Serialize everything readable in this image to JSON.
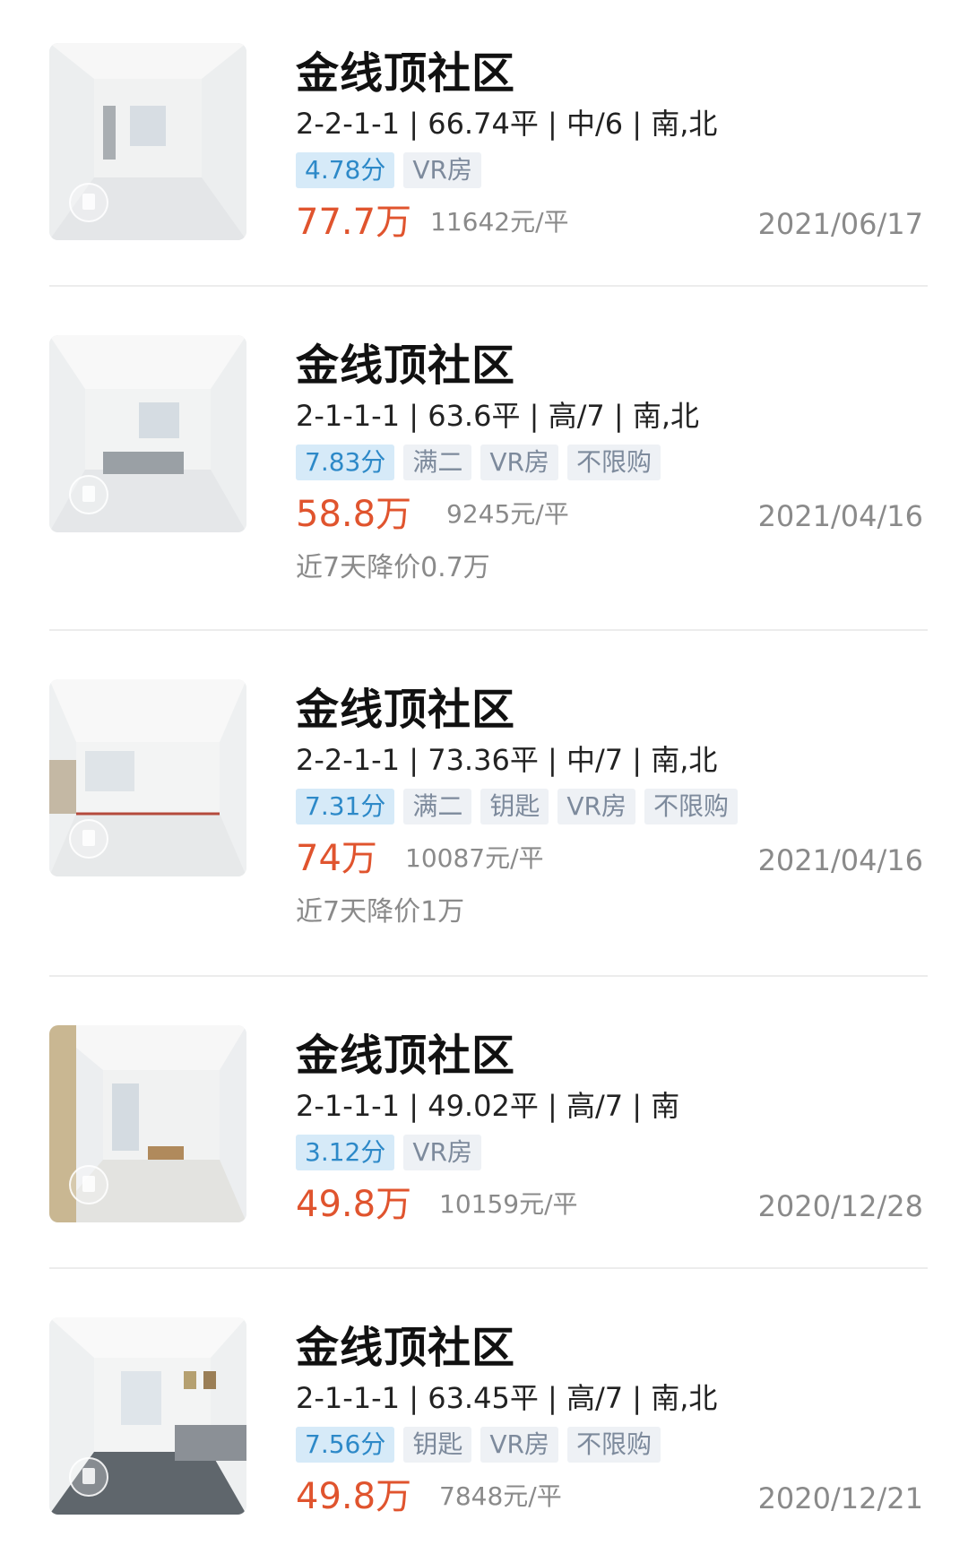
{
  "listings": [
    {
      "title": "金线顶社区",
      "meta": "2-2-1-1 | 66.74平 | 中/6 | 南,北",
      "score": "4.78分",
      "tags": [
        "VR房"
      ],
      "price": "77.7万",
      "unit_price": "11642元/平",
      "date": "2021/06/17",
      "note": ""
    },
    {
      "title": "金线顶社区",
      "meta": "2-1-1-1 | 63.6平 | 高/7 | 南,北",
      "score": "7.83分",
      "tags": [
        "满二",
        "VR房",
        "不限购"
      ],
      "price": "58.8万",
      "unit_price": "9245元/平",
      "date": "2021/04/16",
      "note": "近7天降价0.7万"
    },
    {
      "title": "金线顶社区",
      "meta": "2-2-1-1 | 73.36平 | 中/7 | 南,北",
      "score": "7.31分",
      "tags": [
        "满二",
        "钥匙",
        "VR房",
        "不限购"
      ],
      "price": "74万",
      "unit_price": "10087元/平",
      "date": "2021/04/16",
      "note": "近7天降价1万"
    },
    {
      "title": "金线顶社区",
      "meta": "2-1-1-1 | 49.02平 | 高/7 | 南",
      "score": "3.12分",
      "tags": [
        "VR房"
      ],
      "price": "49.8万",
      "unit_price": "10159元/平",
      "date": "2020/12/28",
      "note": ""
    },
    {
      "title": "金线顶社区",
      "meta": "2-1-1-1 | 63.45平 | 高/7 | 南,北",
      "score": "7.56分",
      "tags": [
        "钥匙",
        "VR房",
        "不限购"
      ],
      "price": "49.8万",
      "unit_price": "7848元/平",
      "date": "2020/12/21",
      "note": ""
    }
  ]
}
